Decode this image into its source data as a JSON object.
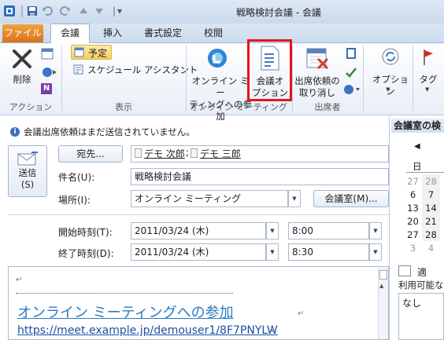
{
  "window": {
    "title": "戦略検討会議 - 会議"
  },
  "qat": {
    "separator": "|",
    "dropdown": "▾"
  },
  "tabs": {
    "file": "ファイル",
    "meeting": "会議",
    "insert": "挿入",
    "format": "書式設定",
    "review": "校閲"
  },
  "ribbon": {
    "delete": "削除",
    "schedule": "予定",
    "scheduling_assistant": "スケジュール アシスタント",
    "online_meeting_line1": "オンライン ミー",
    "online_meeting_line2": "ティングへの参加",
    "meeting_options_line1": "会議オ",
    "meeting_options_line2": "プション",
    "cancel_invite_line1": "出席依頼の",
    "cancel_invite_line2": "取り消し",
    "options": "オプション",
    "tags": "タグ",
    "groups": {
      "actions": "アクション",
      "show": "表示",
      "online_meeting": "オンライン ミーティング",
      "attendees": "出席者"
    }
  },
  "info": {
    "message": "会議出席依頼はまだ送信されていません。"
  },
  "form": {
    "send_line1": "送信",
    "send_line2": "(S)",
    "to_button": "宛先...",
    "recipients": [
      "デモ 次郎",
      "デモ 三郎"
    ],
    "recipient_sep": ";",
    "subject_label": "件名(U):",
    "subject_value": "戦略検討会議",
    "location_label": "場所(I):",
    "location_value": "オンライン ミーティング",
    "rooms_button": "会議室(M)...",
    "start_label": "開始時刻(T):",
    "start_date": "2011/03/24 (木)",
    "start_time": "8:00",
    "end_label": "終了時刻(D):",
    "end_date": "2011/03/24 (木)",
    "end_time": "8:30"
  },
  "body": {
    "join_link": "オンライン ミーティングへの参加",
    "url": "https://meet.example.jp/demouser1/8F7PNYLW",
    "para": "↵"
  },
  "room_finder": {
    "title": "会議室の検",
    "prev": "◀",
    "dow": "日",
    "days": [
      "27",
      "6",
      "13",
      "20",
      "27",
      "3"
    ],
    "days2": [
      "28",
      "7",
      "14",
      "21",
      "28",
      "4"
    ],
    "suitable": "適",
    "available": "利用可能な",
    "none": "なし"
  }
}
